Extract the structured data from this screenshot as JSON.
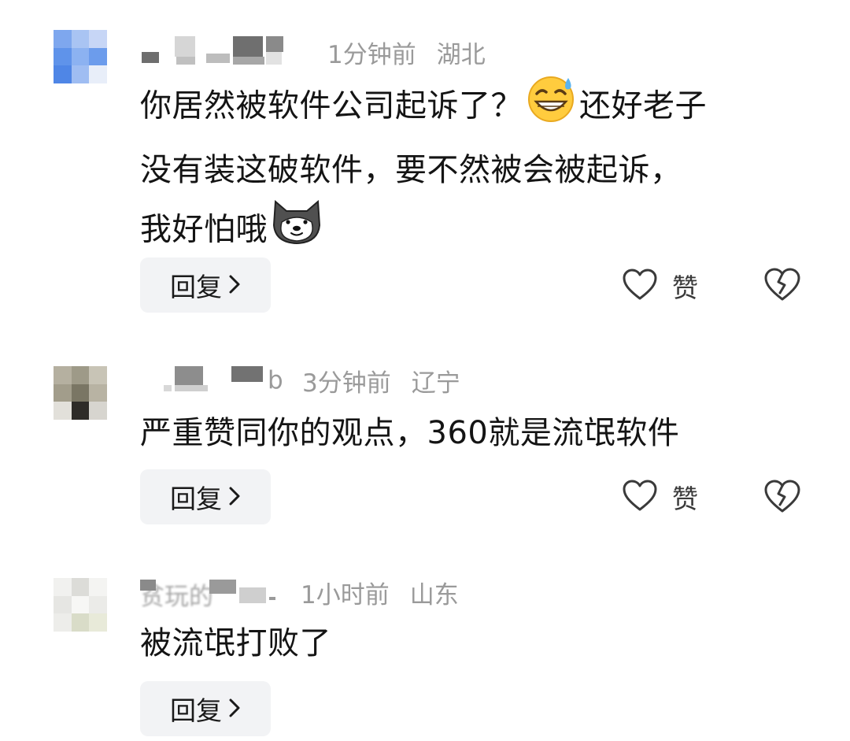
{
  "comments": [
    {
      "time": "1分钟前",
      "location": "湖北",
      "text_lines": [
        "你居然被软件公司起诉了？",
        "还好老子",
        "没有装这破软件，要不然被会被起诉，",
        "我好怕哦"
      ],
      "reply_label": "回复",
      "like_label": "赞",
      "avatar_colors": [
        "#7ea7ee",
        "#a9c4f3",
        "#c7d6f6",
        "#5f93ea",
        "#8cb2f1",
        "#6c9cec",
        "#4f86e6",
        "#9fbdf2",
        "#e8eef9"
      ]
    },
    {
      "username_suffix": "b",
      "time": "3分钟前",
      "location": "辽宁",
      "text": "严重赞同你的观点，360就是流氓软件",
      "reply_label": "回复",
      "like_label": "赞",
      "avatar_colors": [
        "#b5b0a0",
        "#9e9a88",
        "#c8c4b6",
        "#a29d8b",
        "#7a7664",
        "#b8b3a3",
        "#e2e0da",
        "#2e2c28",
        "#d7d5cf"
      ]
    },
    {
      "username_prefix": "贫玩的",
      "time": "1小时前",
      "location": "山东",
      "text": "被流氓打败了",
      "reply_label": "回复",
      "avatar_colors": [
        "#f1f1ef",
        "#dcdcd8",
        "#f4f4f2",
        "#e6e6e3",
        "#f7f7f5",
        "#ebebe8",
        "#ededea",
        "#d9dcc8",
        "#e8ead9"
      ]
    }
  ]
}
